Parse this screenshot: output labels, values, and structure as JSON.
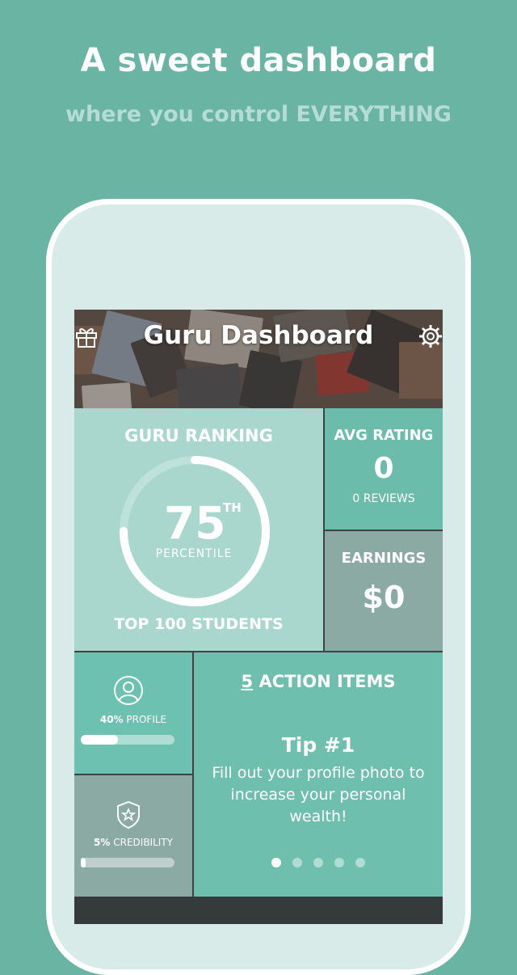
{
  "promo": {
    "headline": "A sweet dashboard",
    "subline": "where you control EVERYTHING"
  },
  "header": {
    "title": "Guru Dashboard",
    "left_icon": "gift-icon",
    "right_icon": "gear-icon"
  },
  "ranking": {
    "title": "GURU RANKING",
    "value": "75",
    "suffix": "TH",
    "unit": "PERCENTILE",
    "footer": "TOP 100 STUDENTS",
    "fraction": 0.75
  },
  "avg_rating": {
    "title": "AVG RATING",
    "value": "0",
    "reviews": "0 REVIEWS"
  },
  "earnings": {
    "title": "EARNINGS",
    "value": "$0"
  },
  "profile": {
    "percent": "40%",
    "label": "PROFILE",
    "fraction": 0.4,
    "icon": "person-icon"
  },
  "credibility": {
    "percent": "5%",
    "label": "CREDIBILITY",
    "fraction": 0.05,
    "icon": "shield-star-icon"
  },
  "actions": {
    "count": "5",
    "title": "ACTION ITEMS",
    "tip_title": "Tip #1",
    "tip_body": "Fill out your profile photo to increase your personal wealth!",
    "pages": 5,
    "active_page": 0
  },
  "colors": {
    "background": "#69b4a3",
    "tile_light": "#a9d7ce",
    "tile_teal": "#6cbcac",
    "tile_gray": "#8aaaa3"
  }
}
